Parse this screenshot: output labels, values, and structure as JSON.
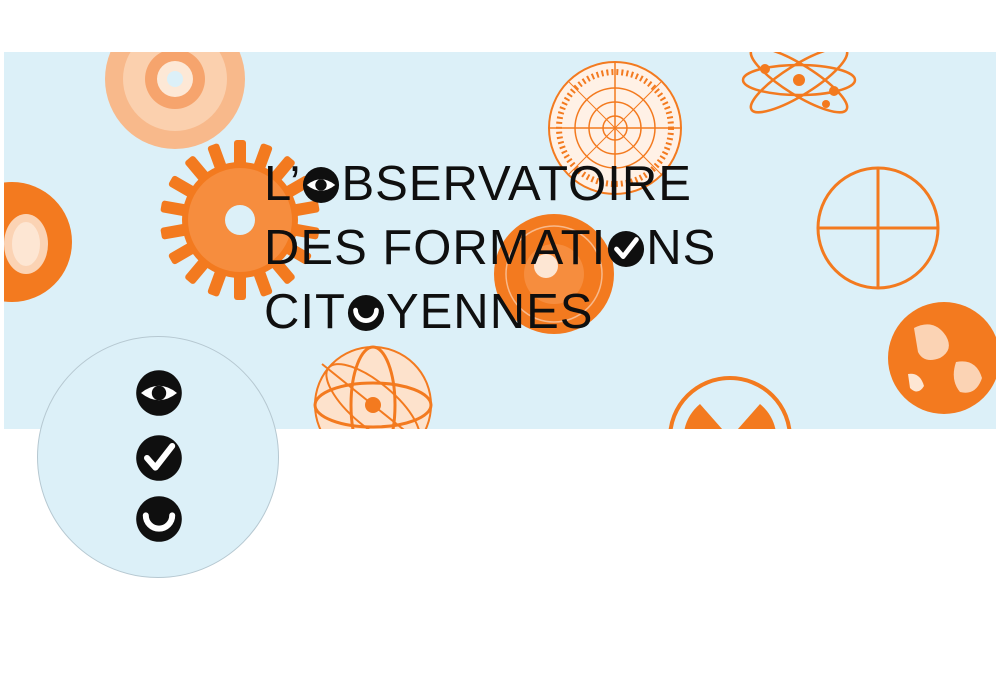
{
  "banner": {
    "background_color": "#dcf0f8",
    "accent_color": "#f37a1f",
    "title": {
      "line1_a": "L’",
      "line1_b": "BSERVATOIRE",
      "line2_a": "DES FORMATI",
      "line2_b": "NS",
      "line3_a": "CIT",
      "line3_b": "YENNES"
    },
    "title_glyphs": [
      "eye-icon",
      "check-icon",
      "smile-icon"
    ],
    "decorations": [
      "cd-disc-icon",
      "radar-dial-icon",
      "atom-icon",
      "cog-wheel-icon",
      "earth-crossed-circle-icon",
      "orange-texture-circle-icon",
      "globe-lit-icon",
      "armillary-sphere-icon",
      "radiation-symbol-icon",
      "earth-planet-icon"
    ]
  },
  "avatar": {
    "icons": [
      "eye-icon",
      "check-icon",
      "smile-icon"
    ]
  }
}
